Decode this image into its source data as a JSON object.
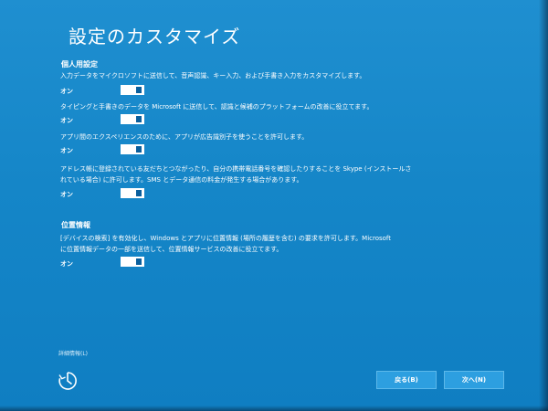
{
  "page": {
    "title": "設定のカスタマイズ"
  },
  "personal": {
    "heading": "個人用設定",
    "items": [
      {
        "lines": [
          "入力データをマイクロソフトに送信して、音声認識、キー入力、および手書き入力をカスタマイズします。"
        ],
        "state": "オン"
      },
      {
        "lines": [
          "タイピングと手書きのデータを Microsoft に送信して、認識と候補のプラットフォームの改善に役立てます。"
        ],
        "state": "オン"
      },
      {
        "lines": [
          "アプリ間のエクスペリエンスのために、アプリが広告識別子を使うことを許可します。"
        ],
        "state": "オン"
      },
      {
        "lines": [
          "アドレス帳に登録されている友だちとつながったり、自分の携帯電話番号を確認したりすることを Skype (インストールさ",
          "れている場合) に許可します。SMS とデータ通信の料金が発生する場合があります。"
        ],
        "state": "オン"
      }
    ]
  },
  "location": {
    "heading": "位置情報",
    "items": [
      {
        "lines": [
          "[デバイスの検索] を有効化し、Windows とアプリに位置情報 (場所の履歴を含む) の要求を許可します。Microsoft",
          "に位置情報データの一部を送信して、位置情報サービスの改善に役立てます。"
        ],
        "state": "オン"
      }
    ]
  },
  "footer": {
    "details_link": "詳細情報(L)",
    "back_button": "戻る(B)",
    "next_button": "次へ(N)",
    "ease_icon": "ease-of-access-icon"
  },
  "colors": {
    "background": "#1586c8",
    "toggle_on": "#ffffff",
    "toggle_thumb": "#0a5f9d",
    "button": "#2d9fe0"
  }
}
